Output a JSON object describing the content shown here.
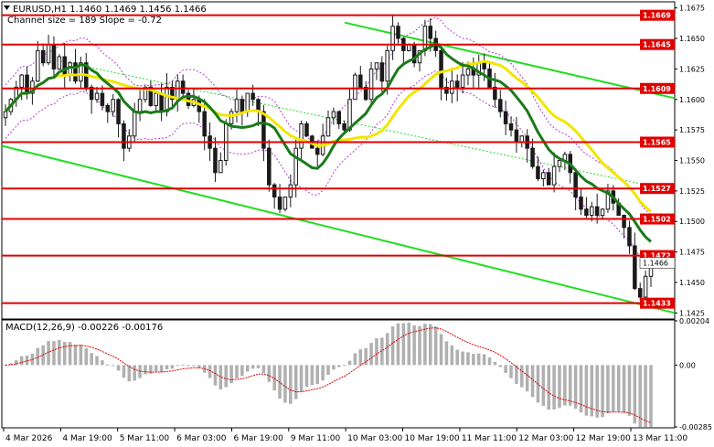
{
  "window": {
    "title": "EURUSD,H1  1.1460 1.1469 1.1456 1.1466",
    "indicator_text": "Channel size = 189 Slope = -0.72",
    "macd_label": "MACD(12,26,9) -0.00226 -0.00176"
  },
  "colors": {
    "background": "#ffffff",
    "bull_candle": "#1a1a1a",
    "bear_candle": "#1a1a1a",
    "ma_green": "#1a7a1a",
    "ma_yellow": "#f2e600",
    "channel": "#22dd22",
    "level": "#e00000",
    "bands": "#b040d0",
    "macd_hist": "#b0b0b0",
    "macd_signal": "#e00000"
  },
  "chart_data": [
    {
      "type": "candlestick",
      "title": "EURUSD,H1  1.1460 1.1469 1.1456 1.1466",
      "ylim": [
        1.142,
        1.168
      ],
      "y_ticks": [
        "1.1675",
        "1.1650",
        "1.1625",
        "1.1600",
        "1.1575",
        "1.1550",
        "1.1525",
        "1.1500",
        "1.1475",
        "1.1450",
        "1.1425"
      ],
      "x_ticks": [
        "4 Mar 2026",
        "4 Mar 19:00",
        "5 Mar 11:00",
        "6 Mar 03:00",
        "6 Mar 19:00",
        "9 Mar 11:00",
        "10 Mar 03:00",
        "10 Mar 19:00",
        "11 Mar 11:00",
        "12 Mar 03:00",
        "12 Mar 19:00",
        "13 Mar 11:00"
      ],
      "current_price": 1.1466,
      "levels": [
        {
          "value": 1.1669,
          "label": "1.1669"
        },
        {
          "value": 1.1645,
          "label": "1.1645"
        },
        {
          "value": 1.1609,
          "label": "1.1609"
        },
        {
          "value": 1.1565,
          "label": "1.1565"
        },
        {
          "value": 1.1527,
          "label": "1.1527"
        },
        {
          "value": 1.1502,
          "label": "1.1502"
        },
        {
          "value": 1.1472,
          "label": "1.1472"
        },
        {
          "value": 1.1433,
          "label": "1.1433"
        }
      ],
      "close": [
        1.159,
        1.16,
        1.161,
        1.162,
        1.1605,
        1.1615,
        1.164,
        1.163,
        1.1645,
        1.1625,
        1.1635,
        1.162,
        1.163,
        1.1615,
        1.163,
        1.161,
        1.16,
        1.1605,
        1.1595,
        1.159,
        1.16,
        1.158,
        1.156,
        1.157,
        1.159,
        1.16,
        1.161,
        1.1595,
        1.1605,
        1.159,
        1.161,
        1.16,
        1.1615,
        1.1605,
        1.1595,
        1.16,
        1.159,
        1.157,
        1.156,
        1.154,
        1.155,
        1.158,
        1.159,
        1.16,
        1.159,
        1.1605,
        1.16,
        1.159,
        1.156,
        1.153,
        1.152,
        1.151,
        1.152,
        1.153,
        1.156,
        1.158,
        1.157,
        1.156,
        1.1555,
        1.157,
        1.1585,
        1.159,
        1.158,
        1.1575,
        1.16,
        1.162,
        1.161,
        1.16,
        1.1625,
        1.163,
        1.1615,
        1.164,
        1.166,
        1.165,
        1.164,
        1.1645,
        1.163,
        1.164,
        1.166,
        1.165,
        1.164,
        1.161,
        1.1605,
        1.1615,
        1.161,
        1.162,
        1.1625,
        1.162,
        1.163,
        1.1625,
        1.161,
        1.16,
        1.159,
        1.158,
        1.1575,
        1.1565,
        1.157,
        1.156,
        1.1545,
        1.1535,
        1.154,
        1.153,
        1.1545,
        1.155,
        1.1555,
        1.154,
        1.152,
        1.151,
        1.1505,
        1.1512,
        1.1505,
        1.151,
        1.1525,
        1.1515,
        1.1505,
        1.1495,
        1.148,
        1.1445,
        1.1438,
        1.1455,
        1.1466
      ],
      "series": [
        {
          "name": "",
          "kind": "sma_fast",
          "color": "#1a7a1a",
          "role": "green moving average"
        },
        {
          "name": "",
          "kind": "sma_slow",
          "color": "#f2e600",
          "role": "yellow moving average"
        }
      ],
      "channel_lines": [
        {
          "from": [
            1.1663,
            0
          ],
          "to": [
            1.1601,
            1
          ],
          "color": "#22dd22"
        },
        {
          "from": [
            1.1562,
            0
          ],
          "to": [
            1.1425,
            1
          ],
          "color": "#22dd22"
        }
      ]
    },
    {
      "type": "bar",
      "title": "MACD(12,26,9) -0.00226 -0.00176",
      "y_ticks": [
        "0.00204",
        "0.00",
        "-0.00285"
      ],
      "ylim": [
        -0.00285,
        0.00204
      ]
    }
  ]
}
